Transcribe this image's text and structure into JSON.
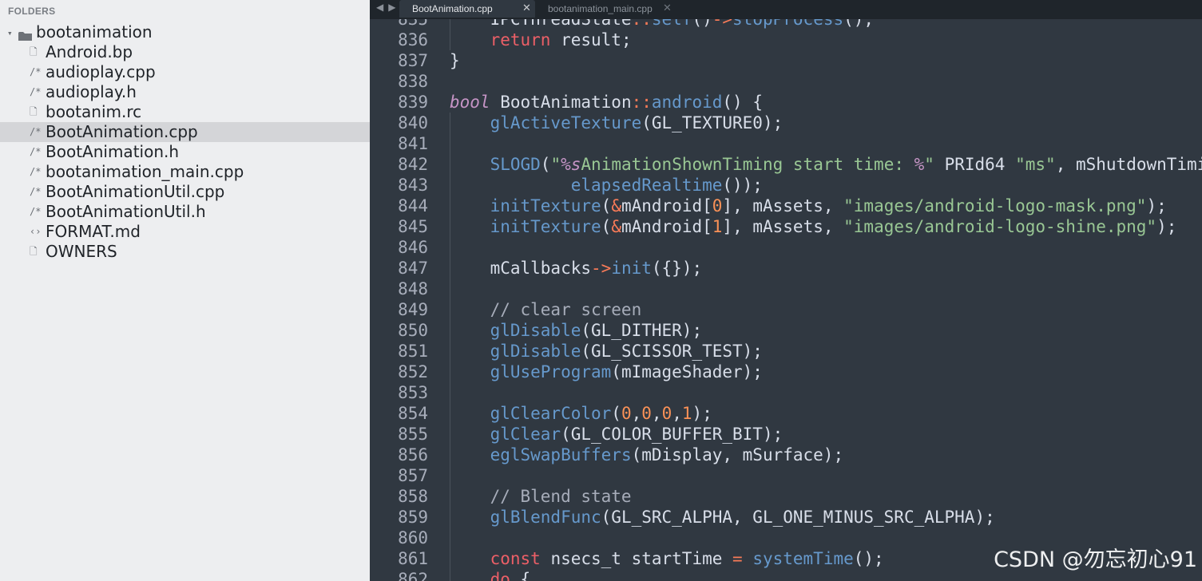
{
  "sidebar": {
    "title": "FOLDERS",
    "folder": {
      "name": "bootanimation",
      "expand_glyph": "▾",
      "icon": "folder-icon"
    },
    "files": [
      {
        "name": "Android.bp",
        "glyph": "🗋",
        "icon": "file-icon",
        "selected": false
      },
      {
        "name": "audioplay.cpp",
        "glyph": "/*",
        "icon": "code-file-icon",
        "selected": false
      },
      {
        "name": "audioplay.h",
        "glyph": "/*",
        "icon": "code-file-icon",
        "selected": false
      },
      {
        "name": "bootanim.rc",
        "glyph": "🗋",
        "icon": "file-icon",
        "selected": false
      },
      {
        "name": "BootAnimation.cpp",
        "glyph": "/*",
        "icon": "code-file-icon",
        "selected": true
      },
      {
        "name": "BootAnimation.h",
        "glyph": "/*",
        "icon": "code-file-icon",
        "selected": false
      },
      {
        "name": "bootanimation_main.cpp",
        "glyph": "/*",
        "icon": "code-file-icon",
        "selected": false
      },
      {
        "name": "BootAnimationUtil.cpp",
        "glyph": "/*",
        "icon": "code-file-icon",
        "selected": false
      },
      {
        "name": "BootAnimationUtil.h",
        "glyph": "/*",
        "icon": "code-file-icon",
        "selected": false
      },
      {
        "name": "FORMAT.md",
        "glyph": "‹›",
        "icon": "markup-file-icon",
        "selected": false
      },
      {
        "name": "OWNERS",
        "glyph": "🗋",
        "icon": "file-icon",
        "selected": false
      }
    ]
  },
  "tabs": {
    "nav_prev": "◀",
    "nav_next": "▶",
    "close_glyph": "✕",
    "items": [
      {
        "label": "BootAnimation.cpp",
        "active": true
      },
      {
        "label": "bootanimation_main.cpp",
        "active": false
      }
    ]
  },
  "editor": {
    "lines": [
      {
        "n": "835",
        "indent": true,
        "tokens": [
          [
            "id",
            "    IPCThreadState"
          ],
          [
            "op",
            "::"
          ],
          [
            "fn",
            "self"
          ],
          [
            "id",
            "()"
          ],
          [
            "op",
            "->"
          ],
          [
            "fn",
            "stopProcess"
          ],
          [
            "id",
            "();"
          ]
        ]
      },
      {
        "n": "836",
        "indent": true,
        "tokens": [
          [
            "id",
            "    "
          ],
          [
            "kw",
            "return"
          ],
          [
            "id",
            " result;"
          ]
        ]
      },
      {
        "n": "837",
        "indent": false,
        "tokens": [
          [
            "id",
            "}"
          ]
        ]
      },
      {
        "n": "838",
        "indent": false,
        "tokens": []
      },
      {
        "n": "839",
        "indent": false,
        "tokens": [
          [
            "type",
            "bool"
          ],
          [
            "id",
            " BootAnimation"
          ],
          [
            "op",
            "::"
          ],
          [
            "fn",
            "android"
          ],
          [
            "id",
            "() {"
          ]
        ]
      },
      {
        "n": "840",
        "indent": true,
        "tokens": [
          [
            "id",
            "    "
          ],
          [
            "fn",
            "glActiveTexture"
          ],
          [
            "id",
            "(GL_TEXTURE0);"
          ]
        ]
      },
      {
        "n": "841",
        "indent": true,
        "tokens": []
      },
      {
        "n": "842",
        "indent": true,
        "tokens": [
          [
            "id",
            "    "
          ],
          [
            "fn",
            "SLOGD"
          ],
          [
            "id",
            "("
          ],
          [
            "str",
            "\""
          ],
          [
            "type",
            "%s"
          ],
          [
            "str",
            "AnimationShownTiming start time: "
          ],
          [
            "type",
            "%"
          ],
          [
            "str",
            "\""
          ],
          [
            "id",
            " PRId64 "
          ],
          [
            "str",
            "\"ms\""
          ],
          [
            "id",
            ", mShutdownTiming,"
          ]
        ]
      },
      {
        "n": "843",
        "indent": true,
        "tokens": [
          [
            "id",
            "            "
          ],
          [
            "fn",
            "elapsedRealtime"
          ],
          [
            "id",
            "());"
          ]
        ]
      },
      {
        "n": "844",
        "indent": true,
        "tokens": [
          [
            "id",
            "    "
          ],
          [
            "fn",
            "initTexture"
          ],
          [
            "id",
            "("
          ],
          [
            "op",
            "&"
          ],
          [
            "id",
            "mAndroid["
          ],
          [
            "num",
            "0"
          ],
          [
            "id",
            "], mAssets, "
          ],
          [
            "str",
            "\"images/android-logo-mask.png\""
          ],
          [
            "id",
            ");"
          ]
        ]
      },
      {
        "n": "845",
        "indent": true,
        "tokens": [
          [
            "id",
            "    "
          ],
          [
            "fn",
            "initTexture"
          ],
          [
            "id",
            "("
          ],
          [
            "op",
            "&"
          ],
          [
            "id",
            "mAndroid["
          ],
          [
            "num",
            "1"
          ],
          [
            "id",
            "], mAssets, "
          ],
          [
            "str",
            "\"images/android-logo-shine.png\""
          ],
          [
            "id",
            ");"
          ]
        ]
      },
      {
        "n": "846",
        "indent": true,
        "tokens": []
      },
      {
        "n": "847",
        "indent": true,
        "tokens": [
          [
            "id",
            "    mCallbacks"
          ],
          [
            "op",
            "->"
          ],
          [
            "fn",
            "init"
          ],
          [
            "id",
            "({});"
          ]
        ]
      },
      {
        "n": "848",
        "indent": true,
        "tokens": []
      },
      {
        "n": "849",
        "indent": true,
        "tokens": [
          [
            "cm",
            "    // clear screen"
          ]
        ]
      },
      {
        "n": "850",
        "indent": true,
        "tokens": [
          [
            "id",
            "    "
          ],
          [
            "fn",
            "glDisable"
          ],
          [
            "id",
            "(GL_DITHER);"
          ]
        ]
      },
      {
        "n": "851",
        "indent": true,
        "tokens": [
          [
            "id",
            "    "
          ],
          [
            "fn",
            "glDisable"
          ],
          [
            "id",
            "(GL_SCISSOR_TEST);"
          ]
        ]
      },
      {
        "n": "852",
        "indent": true,
        "tokens": [
          [
            "id",
            "    "
          ],
          [
            "fn",
            "glUseProgram"
          ],
          [
            "id",
            "(mImageShader);"
          ]
        ]
      },
      {
        "n": "853",
        "indent": true,
        "tokens": []
      },
      {
        "n": "854",
        "indent": true,
        "tokens": [
          [
            "id",
            "    "
          ],
          [
            "fn",
            "glClearColor"
          ],
          [
            "id",
            "("
          ],
          [
            "num",
            "0"
          ],
          [
            "id",
            ","
          ],
          [
            "num",
            "0"
          ],
          [
            "id",
            ","
          ],
          [
            "num",
            "0"
          ],
          [
            "id",
            ","
          ],
          [
            "num",
            "1"
          ],
          [
            "id",
            ");"
          ]
        ]
      },
      {
        "n": "855",
        "indent": true,
        "tokens": [
          [
            "id",
            "    "
          ],
          [
            "fn",
            "glClear"
          ],
          [
            "id",
            "(GL_COLOR_BUFFER_BIT);"
          ]
        ]
      },
      {
        "n": "856",
        "indent": true,
        "tokens": [
          [
            "id",
            "    "
          ],
          [
            "fn",
            "eglSwapBuffers"
          ],
          [
            "id",
            "(mDisplay, mSurface);"
          ]
        ]
      },
      {
        "n": "857",
        "indent": true,
        "tokens": []
      },
      {
        "n": "858",
        "indent": true,
        "tokens": [
          [
            "cm",
            "    // Blend state"
          ]
        ]
      },
      {
        "n": "859",
        "indent": true,
        "tokens": [
          [
            "id",
            "    "
          ],
          [
            "fn",
            "glBlendFunc"
          ],
          [
            "id",
            "(GL_SRC_ALPHA, GL_ONE_MINUS_SRC_ALPHA);"
          ]
        ]
      },
      {
        "n": "860",
        "indent": true,
        "tokens": []
      },
      {
        "n": "861",
        "indent": true,
        "tokens": [
          [
            "id",
            "    "
          ],
          [
            "kw",
            "const"
          ],
          [
            "id",
            " nsecs_t startTime "
          ],
          [
            "op",
            "="
          ],
          [
            "id",
            " "
          ],
          [
            "fn",
            "systemTime"
          ],
          [
            "id",
            "();"
          ]
        ]
      },
      {
        "n": "862",
        "indent": true,
        "tokens": [
          [
            "id",
            "    "
          ],
          [
            "kw",
            "do"
          ],
          [
            "id",
            " {"
          ]
        ]
      }
    ]
  },
  "watermark": "CSDN @勿忘初心91",
  "colors": {
    "editor_bg": "#303841",
    "sidebar_bg": "#edeef0",
    "selected_row": "#d4d5d8",
    "keyword": "#ec5f67",
    "type": "#c594c5",
    "function": "#6699cc",
    "string": "#99c794",
    "number": "#f99157",
    "comment": "#a7adba"
  }
}
